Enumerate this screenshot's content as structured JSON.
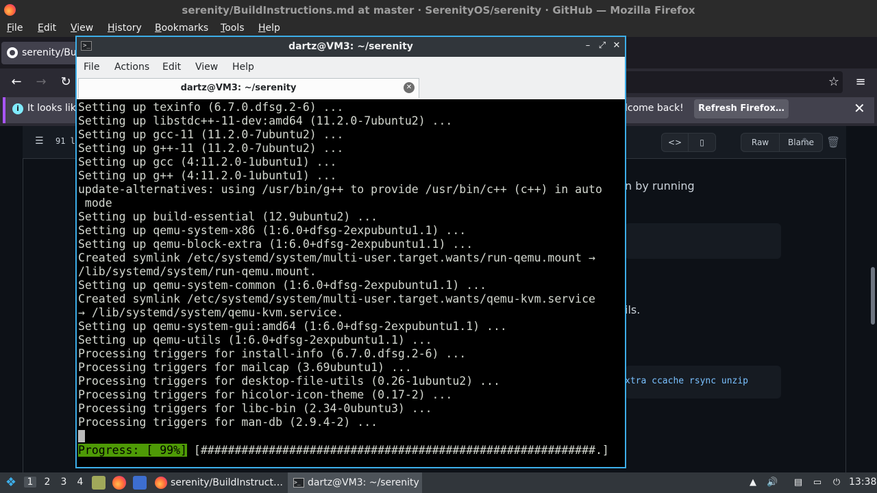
{
  "firefox": {
    "window_title": "serenity/BuildInstructions.md at master · SerenityOS/serenity · GitHub — Mozilla Firefox",
    "menu": [
      "File",
      "Edit",
      "View",
      "History",
      "Bookmarks",
      "Tools",
      "Help"
    ],
    "tab_title": "serenity/BuildInstructions.md",
    "notice": {
      "message_start": "It looks lik",
      "message_end": "lcome back!",
      "refresh_button": "Refresh Firefox…"
    }
  },
  "github": {
    "lines_info": "91 l",
    "raw_label": "Raw",
    "blame_label": "Blame",
    "text_fragment_1": "n by running",
    "text_fragment_2": "ils.",
    "code_fragment": "xtra ccache rsync unzip"
  },
  "terminal": {
    "title": "dartz@VM3: ~/serenity",
    "tab_title": "dartz@VM3: ~/serenity",
    "menu": [
      "File",
      "Actions",
      "Edit",
      "View",
      "Help"
    ],
    "lines": [
      "Setting up texinfo (6.7.0.dfsg.2-6) ...",
      "Setting up libstdc++-11-dev:amd64 (11.2.0-7ubuntu2) ...",
      "Setting up gcc-11 (11.2.0-7ubuntu2) ...",
      "Setting up g++-11 (11.2.0-7ubuntu2) ...",
      "Setting up gcc (4:11.2.0-1ubuntu1) ...",
      "Setting up g++ (4:11.2.0-1ubuntu1) ...",
      "update-alternatives: using /usr/bin/g++ to provide /usr/bin/c++ (c++) in auto",
      " mode",
      "Setting up build-essential (12.9ubuntu2) ...",
      "Setting up qemu-system-x86 (1:6.0+dfsg-2expubuntu1.1) ...",
      "Setting up qemu-block-extra (1:6.0+dfsg-2expubuntu1.1) ...",
      "Created symlink /etc/systemd/system/multi-user.target.wants/run-qemu.mount →",
      "/lib/systemd/system/run-qemu.mount.",
      "Setting up qemu-system-common (1:6.0+dfsg-2expubuntu1.1) ...",
      "Created symlink /etc/systemd/system/multi-user.target.wants/qemu-kvm.service",
      "→ /lib/systemd/system/qemu-kvm.service.",
      "Setting up qemu-system-gui:amd64 (1:6.0+dfsg-2expubuntu1.1) ...",
      "Setting up qemu-utils (1:6.0+dfsg-2expubuntu1.1) ...",
      "Processing triggers for install-info (6.7.0.dfsg.2-6) ...",
      "Processing triggers for mailcap (3.69ubuntu1) ...",
      "Processing triggers for desktop-file-utils (0.26-1ubuntu2) ...",
      "Processing triggers for hicolor-icon-theme (0.17-2) ...",
      "Processing triggers for libc-bin (2.34-0ubuntu3) ...",
      "Processing triggers for man-db (2.9.4-2) ..."
    ],
    "progress_label": "Progress: [ 99%]",
    "progress_bar": " [##########################################################.]",
    "progress_percent": 99
  },
  "taskbar": {
    "desktops": [
      "1",
      "2",
      "3",
      "4"
    ],
    "active_desktop": "1",
    "tasks": [
      {
        "label": "serenity/BuildInstruct…",
        "icon": "firefox-icon"
      },
      {
        "label": "dartz@VM3: ~/serenity",
        "icon": "terminal-icon"
      }
    ],
    "clock": "13:38"
  },
  "colors": {
    "terminal_border": "#3daee9",
    "progress_green": "#4e9a06",
    "notice_accent": "#a855f7"
  }
}
